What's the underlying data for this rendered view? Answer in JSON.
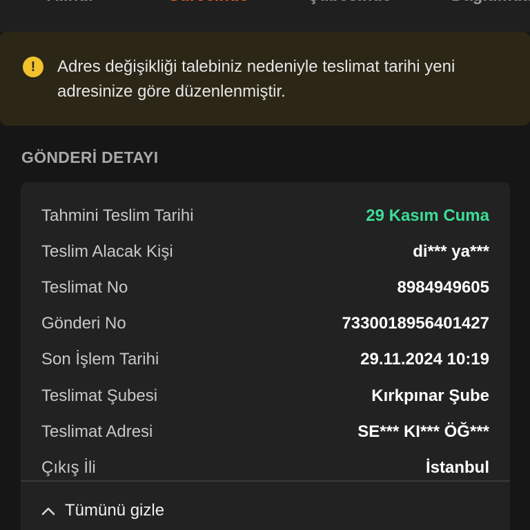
{
  "tabs": [
    {
      "label": "Alındı",
      "active": false
    },
    {
      "label": "Sürecinde",
      "active": true
    },
    {
      "label": "Şubesinde",
      "active": false
    },
    {
      "label": "Dağıtımda",
      "active": false
    }
  ],
  "banner": {
    "icon": "warning-icon",
    "text": "Adres değişikliği talebiniz nedeniyle teslimat tarihi yeni adresinize göre düzenlenmiştir."
  },
  "section": {
    "title": "GÖNDERİ DETAYI"
  },
  "details": [
    {
      "label": "Tahmini Teslim Tarihi",
      "value": "29 Kasım Cuma"
    },
    {
      "label": "Teslim Alacak Kişi",
      "value": "di*** ya***"
    },
    {
      "label": "Teslimat No",
      "value": "8984949605"
    },
    {
      "label": "Gönderi No",
      "value": "7330018956401427"
    },
    {
      "label": "Son İşlem Tarihi",
      "value": "29.11.2024 10:19"
    },
    {
      "label": "Teslimat Şubesi",
      "value": "Kırkpınar Şube"
    },
    {
      "label": "Teslimat Adresi",
      "value": "SE*** KI*** ÖĞ***"
    },
    {
      "label": "Çıkış İli",
      "value": "İstanbul"
    }
  ],
  "toggle": {
    "label": "Tümünü gizle",
    "icon": "chevron-up-icon"
  },
  "colors": {
    "accent": "#ff6a2b",
    "success": "#3ddc97",
    "warning": "#f2c12e",
    "background": "#161616",
    "card": "#222222"
  }
}
